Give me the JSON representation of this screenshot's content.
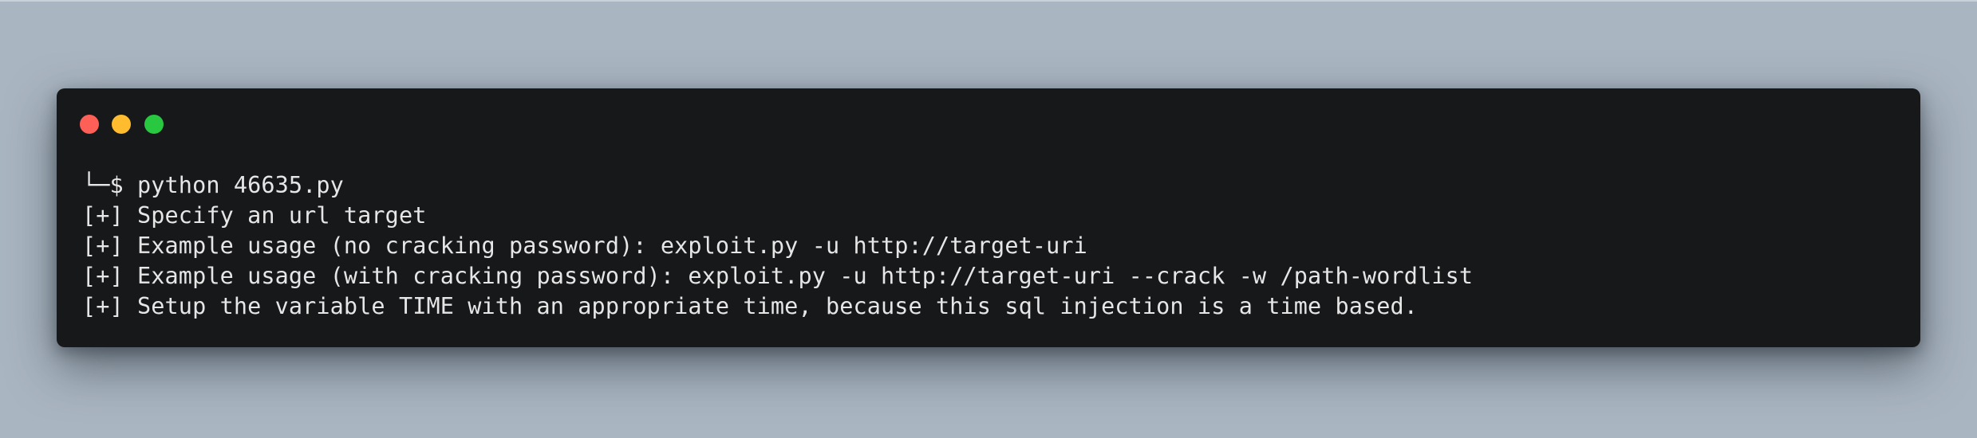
{
  "window": {
    "controls": [
      {
        "name": "close",
        "color": "#fe5f57"
      },
      {
        "name": "minimize",
        "color": "#febc2e"
      },
      {
        "name": "zoom",
        "color": "#28c840"
      }
    ],
    "background_color": "#17181a",
    "desktop_color": "#a9b5c1"
  },
  "terminal": {
    "lines": [
      "└─$ python 46635.py",
      "[+] Specify an url target",
      "[+] Example usage (no cracking password): exploit.py -u http://target-uri",
      "[+] Example usage (with cracking password): exploit.py -u http://target-uri --crack -w /path-wordlist",
      "[+] Setup the variable TIME with an appropriate time, because this sql injection is a time based."
    ],
    "text_color": "#e6e6e6"
  }
}
